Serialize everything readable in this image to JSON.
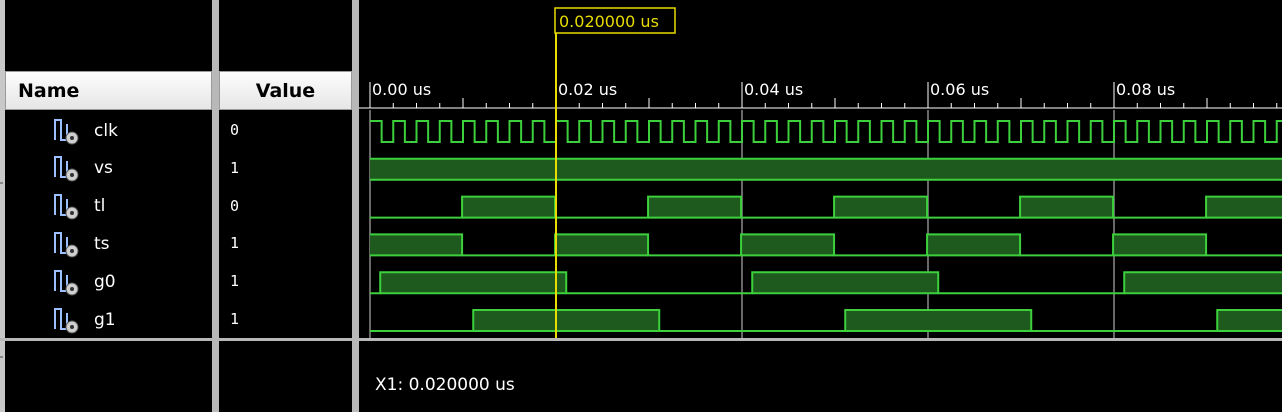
{
  "columns": {
    "name_header": "Name",
    "value_header": "Value"
  },
  "cursor": {
    "label": "0.020000 us",
    "time_us": 0.02,
    "readout": "X1: 0.020000 us"
  },
  "timeline": {
    "start_us": 0,
    "end_us": 0.098,
    "major_ticks": [
      {
        "t": 0.0,
        "label": "0.00 us"
      },
      {
        "t": 0.02,
        "label": "0.02 us"
      },
      {
        "t": 0.04,
        "label": "0.04 us"
      },
      {
        "t": 0.06,
        "label": "0.06 us"
      },
      {
        "t": 0.08,
        "label": "0.08 us"
      }
    ],
    "minor_tick_us": 0.0025
  },
  "signals": [
    {
      "name": "clk",
      "value": "0",
      "kind": "clock",
      "period_us": 0.0025,
      "initial": 1
    },
    {
      "name": "vs",
      "value": "1",
      "initial": 1,
      "edges_us": []
    },
    {
      "name": "tl",
      "value": "0",
      "initial": 0,
      "edges_us": [
        0.0099,
        0.0199,
        0.0299,
        0.0399,
        0.0499,
        0.0599,
        0.0699,
        0.0799,
        0.0899
      ]
    },
    {
      "name": "ts",
      "value": "1",
      "initial": 1,
      "edges_us": [
        0.0099,
        0.0199,
        0.0299,
        0.0399,
        0.0499,
        0.0599,
        0.0699,
        0.0799,
        0.0899
      ]
    },
    {
      "name": "g0",
      "value": "1",
      "initial": 0,
      "edges_us": [
        0.0011,
        0.0211,
        0.0411,
        0.0611,
        0.0811
      ]
    },
    {
      "name": "g1",
      "value": "1",
      "initial": 0,
      "edges_us": [
        0.0111,
        0.0311,
        0.0511,
        0.0711,
        0.0911
      ]
    }
  ],
  "colors": {
    "waveform_line": "#3cd03c",
    "waveform_fill": "#1e5a1e",
    "cursor": "#e8dc00",
    "grid_line": "#d0d0d0",
    "axis_text": "#ffffff",
    "panel_separator": "#b8b8b8"
  },
  "icons": {
    "signal_icon": "logic-signal-icon"
  }
}
